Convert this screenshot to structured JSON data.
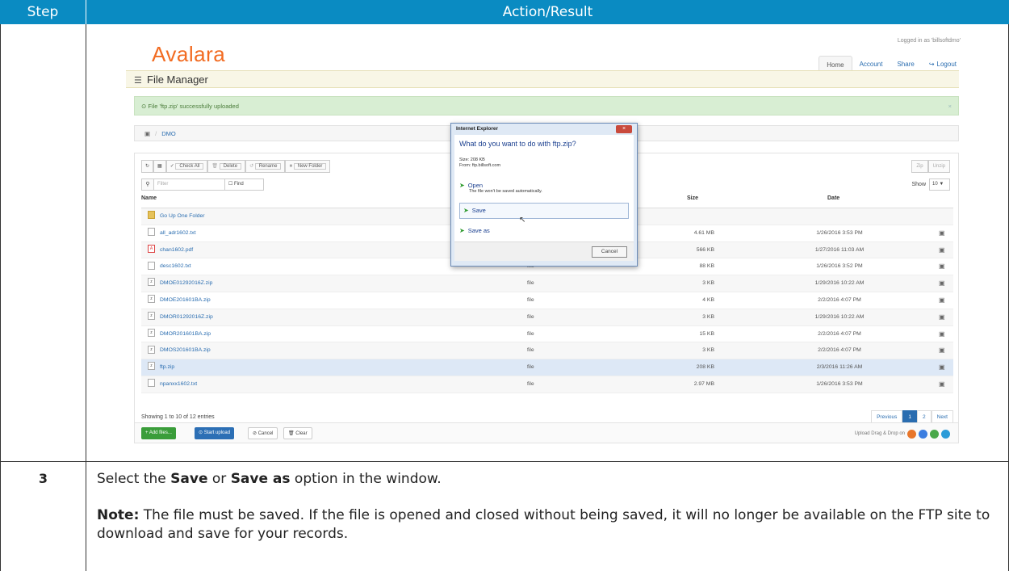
{
  "table": {
    "header_step": "Step",
    "header_action": "Action/Result",
    "step_number": "3",
    "instruction": {
      "prefix": "Select the ",
      "save": "Save",
      "or": " or ",
      "save_as": "Save as",
      "suffix": " option in the window.",
      "note_label": "Note:",
      "note_text": " The file must be saved.  If the file is opened and closed without being saved, it will no longer be available on the FTP site to download and save for your records."
    }
  },
  "app": {
    "logo": "Avalara",
    "logged_in": "Logged in as 'billsoftdmo'",
    "nav": [
      "Home",
      "Account",
      "Share",
      "Logout"
    ],
    "page_title": "File Manager",
    "alert": "File 'ftp.zip' successfully uploaded",
    "breadcrumb": "DMO",
    "toolbar": [
      "Check All",
      "Delete",
      "Rename",
      "New Folder"
    ],
    "toolbar_right": [
      "Zip",
      "Unzip"
    ],
    "filter_placeholder": "Filter",
    "find_label": "Find",
    "show_label": "Show",
    "show_value": "10",
    "columns": {
      "name": "Name",
      "size": "Size",
      "date": "Date"
    },
    "rows": [
      {
        "name": "Go Up One Folder",
        "type": "",
        "size": "",
        "date": "",
        "icon": "folder"
      },
      {
        "name": "all_adr1602.txt",
        "type": "",
        "size": "4.61 MB",
        "date": "1/26/2016 3:53 PM",
        "icon": "txt"
      },
      {
        "name": "chan1602.pdf",
        "type": "",
        "size": "566 KB",
        "date": "1/27/2016 11:03 AM",
        "icon": "pdf"
      },
      {
        "name": "desc1602.txt",
        "type": "file",
        "size": "88 KB",
        "date": "1/26/2016 3:52 PM",
        "icon": "txt"
      },
      {
        "name": "DMOE01292016Z.zip",
        "type": "file",
        "size": "3 KB",
        "date": "1/29/2016 10:22 AM",
        "icon": "zip"
      },
      {
        "name": "DMOE201601BA.zip",
        "type": "file",
        "size": "4 KB",
        "date": "2/2/2016 4:07 PM",
        "icon": "zip"
      },
      {
        "name": "DMOR01292016Z.zip",
        "type": "file",
        "size": "3 KB",
        "date": "1/29/2016 10:22 AM",
        "icon": "zip"
      },
      {
        "name": "DMOR201601BA.zip",
        "type": "file",
        "size": "15 KB",
        "date": "2/2/2016 4:07 PM",
        "icon": "zip"
      },
      {
        "name": "DMOS201601BA.zip",
        "type": "file",
        "size": "3 KB",
        "date": "2/2/2016 4:07 PM",
        "icon": "zip"
      },
      {
        "name": "ftp.zip",
        "type": "file",
        "size": "208 KB",
        "date": "2/3/2016 11:26 AM",
        "icon": "zip"
      },
      {
        "name": "npanxx1602.txt",
        "type": "file",
        "size": "2.97 MB",
        "date": "1/26/2016 3:53 PM",
        "icon": "txt"
      }
    ],
    "entries_info": "Showing 1 to 10 of 12 entries",
    "pager": [
      "Previous",
      "1",
      "2",
      "Next"
    ],
    "upload_buttons": [
      "Add files...",
      "Start upload",
      "Cancel",
      "Clear"
    ],
    "upload_dragdrop": "Upload Drag & Drop on"
  },
  "dialog": {
    "title": "Internet Explorer",
    "question": "What do you want to do with ftp.zip?",
    "size_line": "Size: 208 KB",
    "from_line": "From: ftp.billsoft.com",
    "open_label": "Open",
    "open_sub": "The file won't be saved automatically.",
    "save_label": "Save",
    "save_as_label": "Save as",
    "cancel_label": "Cancel"
  }
}
